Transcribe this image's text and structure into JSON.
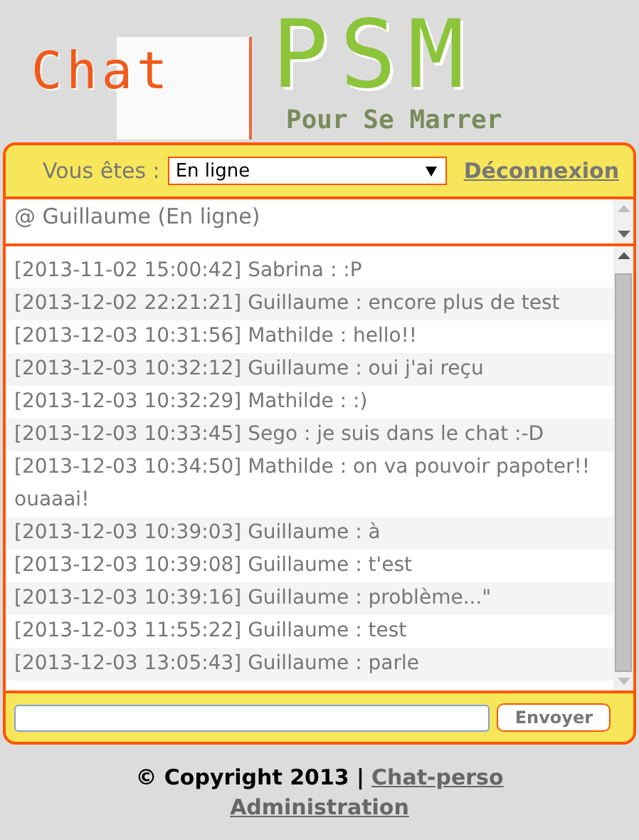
{
  "logo": {
    "word": "Chat",
    "mark": "PSM",
    "tagline": "Pour Se Marrer"
  },
  "status_bar": {
    "label": "Vous êtes :",
    "value": "En ligne",
    "logout": "Déconnexion"
  },
  "users": [
    "@ Guillaume (En ligne)"
  ],
  "messages": [
    {
      "text": "[2013-11-02 15:00:42] Sabrina : :P"
    },
    {
      "text": "[2013-12-02 22:21:21] Guillaume : encore plus de test"
    },
    {
      "text": "[2013-12-03 10:31:56] Mathilde : hello!!"
    },
    {
      "text": "[2013-12-03 10:32:12] Guillaume : oui j'ai reçu"
    },
    {
      "text": "[2013-12-03 10:32:29] Mathilde : :)"
    },
    {
      "text": "[2013-12-03 10:33:45] Sego : je suis dans le chat :-D"
    },
    {
      "text": "[2013-12-03 10:34:50] Mathilde : on va pouvoir papoter!! ouaaai!"
    },
    {
      "text": "[2013-12-03 10:39:03] Guillaume : à"
    },
    {
      "text": "[2013-12-03 10:39:08] Guillaume : t'est"
    },
    {
      "text": "[2013-12-03 10:39:16] Guillaume : problème...\""
    },
    {
      "text": "[2013-12-03 11:55:22] Guillaume : test"
    },
    {
      "text": "[2013-12-03 13:05:43] Guillaume : parle"
    }
  ],
  "composer": {
    "send": "Envoyer"
  },
  "footer": {
    "copyright": "© Copyright 2013 |",
    "link": "Chat-perso",
    "admin": "Administration"
  }
}
